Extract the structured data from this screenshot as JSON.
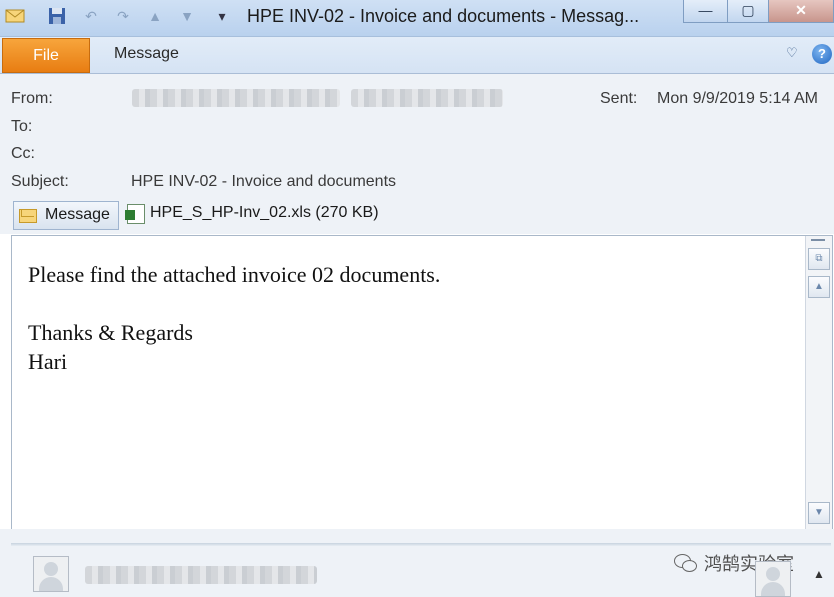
{
  "window": {
    "title": "HPE INV-02 - Invoice and documents  -  Messag...",
    "controls": {
      "minimize": "—",
      "maximize": "▢",
      "close": "✕"
    }
  },
  "quick_access": [
    "mail-icon",
    "save-icon",
    "undo-icon",
    "redo-icon",
    "up-icon",
    "down-icon",
    "customize-icon"
  ],
  "ribbon": {
    "file_tab": "File",
    "message_tab": "Message",
    "help_label": "?"
  },
  "header": {
    "from_label": "From:",
    "to_label": "To:",
    "cc_label": "Cc:",
    "subject_label": "Subject:",
    "subject_value": "HPE INV-02 - Invoice and documents",
    "sent_label": "Sent:",
    "sent_value": "Mon 9/9/2019 5:14 AM"
  },
  "attachments": {
    "message_button": "Message",
    "file_name": "HPE_S_HP-Inv_02.xls (270 KB)"
  },
  "body": {
    "lines": [
      "Please find the attached invoice 02 documents.",
      "",
      "Thanks & Regards",
      "Hari"
    ]
  },
  "footer": {
    "watermark": "鸿鹄实验室"
  },
  "colors": {
    "file_tab": "#e87d12",
    "titlebar": "#c4d8f1",
    "header_bg": "#eef2f7"
  }
}
